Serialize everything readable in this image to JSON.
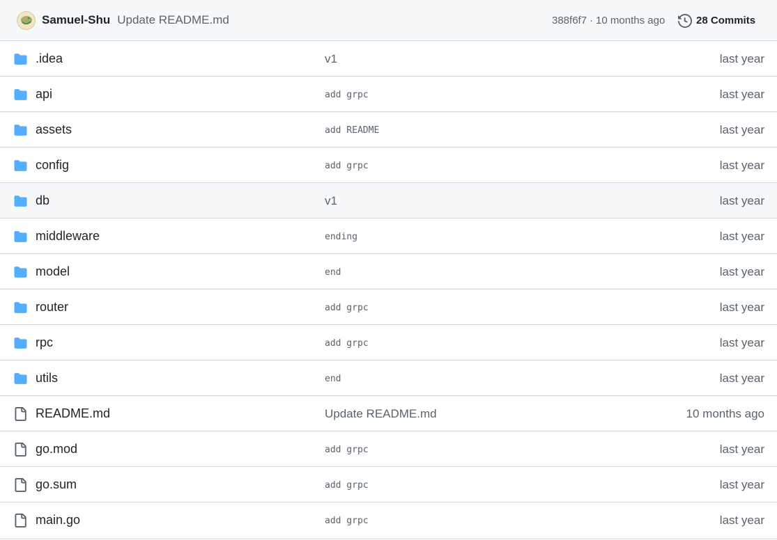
{
  "latest_commit": {
    "author": "Samuel-Shu",
    "message": "Update README.md",
    "sha": "388f6f7",
    "separator": "·",
    "time": "10 months ago",
    "commits_count": "28",
    "commits_label": "Commits"
  },
  "colors": {
    "folder": "#54aeff",
    "file": "#59636e",
    "border": "#d0d7de",
    "header_bg": "#f6f8fa",
    "muted_text": "#59636e"
  },
  "files": [
    {
      "type": "folder",
      "icon": "folder-icon",
      "name": ".idea",
      "message": "v1",
      "msg_style": "sans",
      "age": "last year",
      "hover": false
    },
    {
      "type": "folder",
      "icon": "folder-icon",
      "name": "api",
      "message": "add grpc",
      "msg_style": "mono",
      "age": "last year",
      "hover": false
    },
    {
      "type": "folder",
      "icon": "folder-icon",
      "name": "assets",
      "message": "add README",
      "msg_style": "mono",
      "age": "last year",
      "hover": false
    },
    {
      "type": "folder",
      "icon": "folder-icon",
      "name": "config",
      "message": "add grpc",
      "msg_style": "mono",
      "age": "last year",
      "hover": false
    },
    {
      "type": "folder",
      "icon": "folder-icon",
      "name": "db",
      "message": "v1",
      "msg_style": "sans",
      "age": "last year",
      "hover": true
    },
    {
      "type": "folder",
      "icon": "folder-icon",
      "name": "middleware",
      "message": "ending",
      "msg_style": "mono",
      "age": "last year",
      "hover": false
    },
    {
      "type": "folder",
      "icon": "folder-icon",
      "name": "model",
      "message": "end",
      "msg_style": "mono",
      "age": "last year",
      "hover": false
    },
    {
      "type": "folder",
      "icon": "folder-icon",
      "name": "router",
      "message": "add grpc",
      "msg_style": "mono",
      "age": "last year",
      "hover": false
    },
    {
      "type": "folder",
      "icon": "folder-icon",
      "name": "rpc",
      "message": "add grpc",
      "msg_style": "mono",
      "age": "last year",
      "hover": false
    },
    {
      "type": "folder",
      "icon": "folder-icon",
      "name": "utils",
      "message": "end",
      "msg_style": "mono",
      "age": "last year",
      "hover": false
    },
    {
      "type": "file",
      "icon": "file-icon",
      "name": "README.md",
      "message": "Update README.md",
      "msg_style": "sans",
      "age": "10 months ago",
      "hover": false
    },
    {
      "type": "file",
      "icon": "file-icon",
      "name": "go.mod",
      "message": "add grpc",
      "msg_style": "mono",
      "age": "last year",
      "hover": false
    },
    {
      "type": "file",
      "icon": "file-icon",
      "name": "go.sum",
      "message": "add grpc",
      "msg_style": "mono",
      "age": "last year",
      "hover": false
    },
    {
      "type": "file",
      "icon": "file-icon",
      "name": "main.go",
      "message": "add grpc",
      "msg_style": "mono",
      "age": "last year",
      "hover": false
    }
  ]
}
